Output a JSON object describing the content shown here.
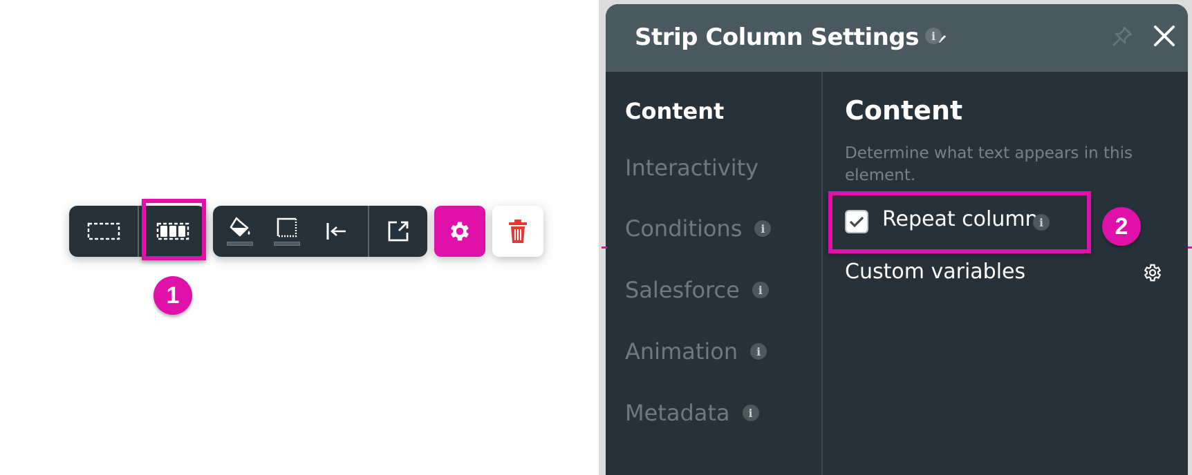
{
  "toolbar": {
    "groups": [
      {
        "buttons": [
          {
            "name": "strip-layout-single",
            "icon": "dashed-rectangle-icon"
          },
          {
            "name": "strip-layout-columns",
            "icon": "dashed-columns-icon",
            "highlighted": true
          }
        ]
      },
      {
        "buttons": [
          {
            "name": "background-color",
            "icon": "paint-bucket-icon"
          },
          {
            "name": "border",
            "icon": "border-icon"
          },
          {
            "name": "alignment",
            "icon": "align-left-arrow-icon"
          },
          {
            "name": "external-link",
            "icon": "open-external-icon"
          }
        ]
      }
    ],
    "settings_button": {
      "icon": "gear-icon",
      "active": true
    },
    "delete_button": {
      "icon": "trash-icon"
    }
  },
  "annotations": [
    {
      "label": "1",
      "target": "strip-layout-columns"
    },
    {
      "label": "2",
      "target": "repeat-column"
    }
  ],
  "panel": {
    "title": "Strip Column Settings",
    "title_dropdown_icon": "chevron-down-icon",
    "info_glyph": "i",
    "pin_icon": "pin-icon",
    "close_icon": "close-icon",
    "nav": [
      {
        "label": "Content",
        "active": true,
        "info": false
      },
      {
        "label": "Interactivity",
        "active": false,
        "info": false
      },
      {
        "label": "Conditions",
        "active": false,
        "info": true
      },
      {
        "label": "Salesforce",
        "active": false,
        "info": true
      },
      {
        "label": "Animation",
        "active": false,
        "info": true
      },
      {
        "label": "Metadata",
        "active": false,
        "info": true
      }
    ],
    "content": {
      "heading": "Content",
      "description": "Determine what text appears in this element.",
      "repeat_column": {
        "label": "Repeat column",
        "checked": true
      },
      "custom_variables": {
        "label": "Custom variables",
        "icon": "gear-icon"
      }
    }
  },
  "colors": {
    "accent": "#e011a8",
    "toolbar_bg": "#263139",
    "panel_header": "#4a5860",
    "panel_body": "#263139",
    "delete_red": "#e53935"
  }
}
